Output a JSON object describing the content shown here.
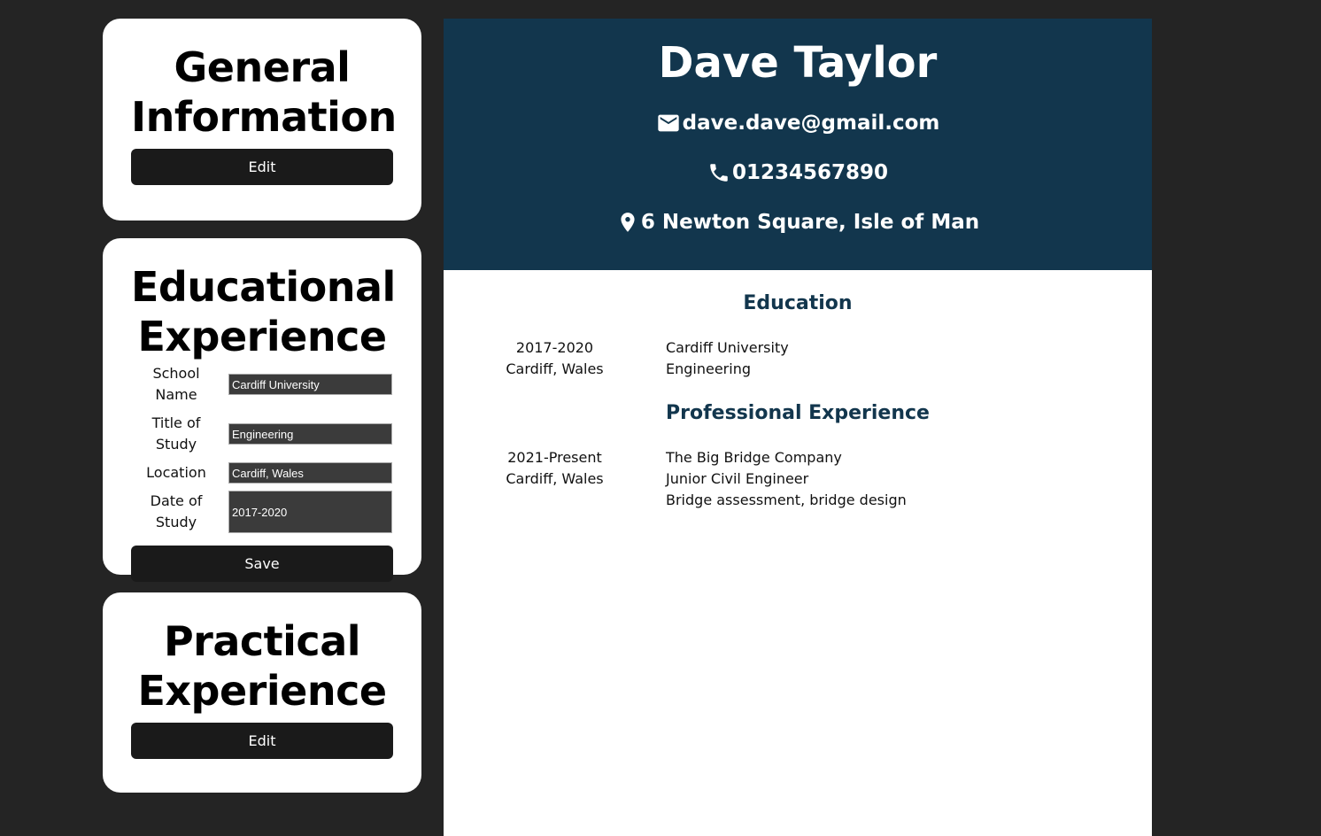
{
  "sidebar": {
    "general": {
      "title_line1": "General",
      "title_line2": "Information",
      "edit_label": "Edit"
    },
    "educational": {
      "title_line1": "Educational",
      "title_line2": "Experience",
      "fields": {
        "school_label": "School Name",
        "school_value": "Cardiff University",
        "study_label": "Title of Study",
        "study_value": "Engineering",
        "location_label": "Location",
        "location_value": "Cardiff, Wales",
        "date_label_line1": "Date of",
        "date_label_line2": "Study",
        "date_value": "2017-2020"
      },
      "save_label": "Save"
    },
    "practical": {
      "title_line1": "Practical",
      "title_line2": "Experience",
      "edit_label": "Edit"
    }
  },
  "resume": {
    "name": "Dave Taylor",
    "email": "dave.dave@gmail.com",
    "phone": "01234567890",
    "address": "6 Newton Square, Isle of Man",
    "colors": {
      "header_bg": "#12364d",
      "section_title": "#12364d"
    },
    "education": {
      "title": "Education",
      "entries": [
        {
          "dates": "2017-2020",
          "location": "Cardiff, Wales",
          "school": "Cardiff University",
          "study": "Engineering"
        }
      ]
    },
    "professional": {
      "title": "Professional Experience",
      "entries": [
        {
          "dates": "2021-Present",
          "location": "Cardiff, Wales",
          "company": "The Big Bridge Company",
          "position": "Junior Civil Engineer",
          "responsibilities": "Bridge assessment, bridge design"
        }
      ]
    }
  },
  "icons": {
    "email": "mail-icon",
    "phone": "phone-icon",
    "address": "location-pin-icon"
  }
}
